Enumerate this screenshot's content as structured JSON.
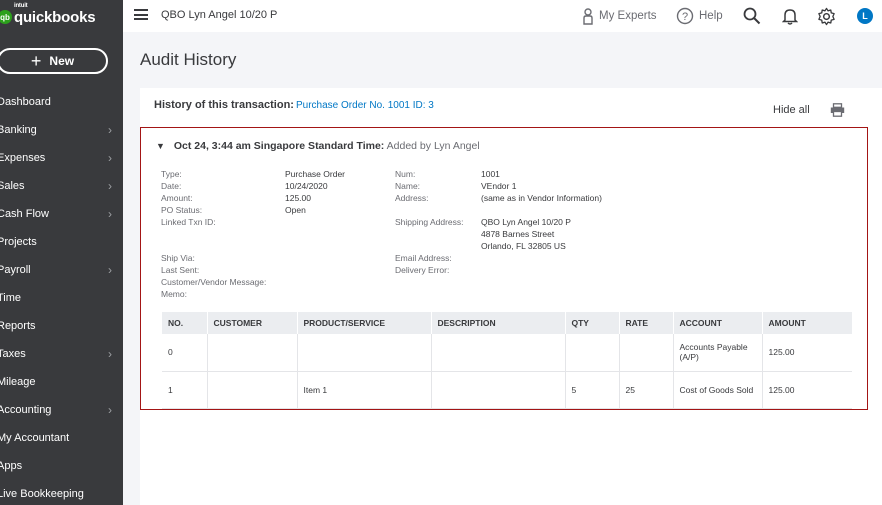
{
  "sidebar": {
    "logo_intuit": "intuit",
    "logo_text": "quickbooks",
    "logo_badge": "qb",
    "new_label": "New",
    "items": [
      {
        "label": "Dashboard",
        "chevron": false
      },
      {
        "label": "Banking",
        "chevron": true
      },
      {
        "label": "Expenses",
        "chevron": true
      },
      {
        "label": "Sales",
        "chevron": true
      },
      {
        "label": "Cash Flow",
        "chevron": true
      },
      {
        "label": "Projects",
        "chevron": false
      },
      {
        "label": "Payroll",
        "chevron": true
      },
      {
        "label": "Time",
        "chevron": false
      },
      {
        "label": "Reports",
        "chevron": false
      },
      {
        "label": "Taxes",
        "chevron": true
      },
      {
        "label": "Mileage",
        "chevron": false
      },
      {
        "label": "Accounting",
        "chevron": true
      },
      {
        "label": "My Accountant",
        "chevron": false
      },
      {
        "label": "Apps",
        "chevron": false
      },
      {
        "label": "Live Bookkeeping",
        "chevron": false
      }
    ]
  },
  "topbar": {
    "company_name": "QBO Lyn Angel 10/20 P",
    "my_experts": "My Experts",
    "help": "Help",
    "avatar_initial": "L"
  },
  "page": {
    "title": "Audit History",
    "history_label": "History of this transaction:",
    "history_link": "Purchase Order No. 1001 ID: 3",
    "hide_all": "Hide all"
  },
  "entry": {
    "timestamp": "Oct 24, 3:44 am Singapore Standard Time:",
    "action": "Added by Lyn Angel",
    "left_fields": [
      {
        "label": "Type:",
        "value": "Purchase Order"
      },
      {
        "label": "Date:",
        "value": "10/24/2020"
      },
      {
        "label": "Amount:",
        "value": "125.00"
      },
      {
        "label": "PO Status:",
        "value": "Open"
      },
      {
        "label": "Linked Txn ID:",
        "value": ""
      }
    ],
    "right_fields": [
      {
        "label": "Num:",
        "value": "1001"
      },
      {
        "label": "Name:",
        "value": "VEndor 1"
      },
      {
        "label": "Address:",
        "value": "(same as in Vendor Information)"
      }
    ],
    "shipping_label": "Shipping Address:",
    "shipping_lines": [
      "QBO Lyn Angel 10/20 P",
      "4878  Barnes Street",
      "Orlando, FL  32805 US"
    ],
    "lower_left_labels": [
      "Ship Via:",
      "Last Sent:",
      "Customer/Vendor Message:",
      "Memo:"
    ],
    "lower_right_labels": [
      "Email Address:",
      "Delivery Error:"
    ],
    "table": {
      "headers": [
        "NO.",
        "CUSTOMER",
        "PRODUCT/SERVICE",
        "DESCRIPTION",
        "QTY",
        "RATE",
        "ACCOUNT",
        "AMOUNT"
      ],
      "rows": [
        [
          "0",
          "",
          "",
          "",
          "",
          "",
          "Accounts Payable (A/P)",
          "125.00"
        ],
        [
          "1",
          "",
          "Item 1",
          "",
          "5",
          "25",
          "Cost of Goods Sold",
          "125.00"
        ]
      ]
    }
  },
  "colors": {
    "sidebar_bg": "#393a3d",
    "brand_green": "#2ca01c",
    "link_blue": "#0077c5",
    "audit_border": "#a31515"
  }
}
